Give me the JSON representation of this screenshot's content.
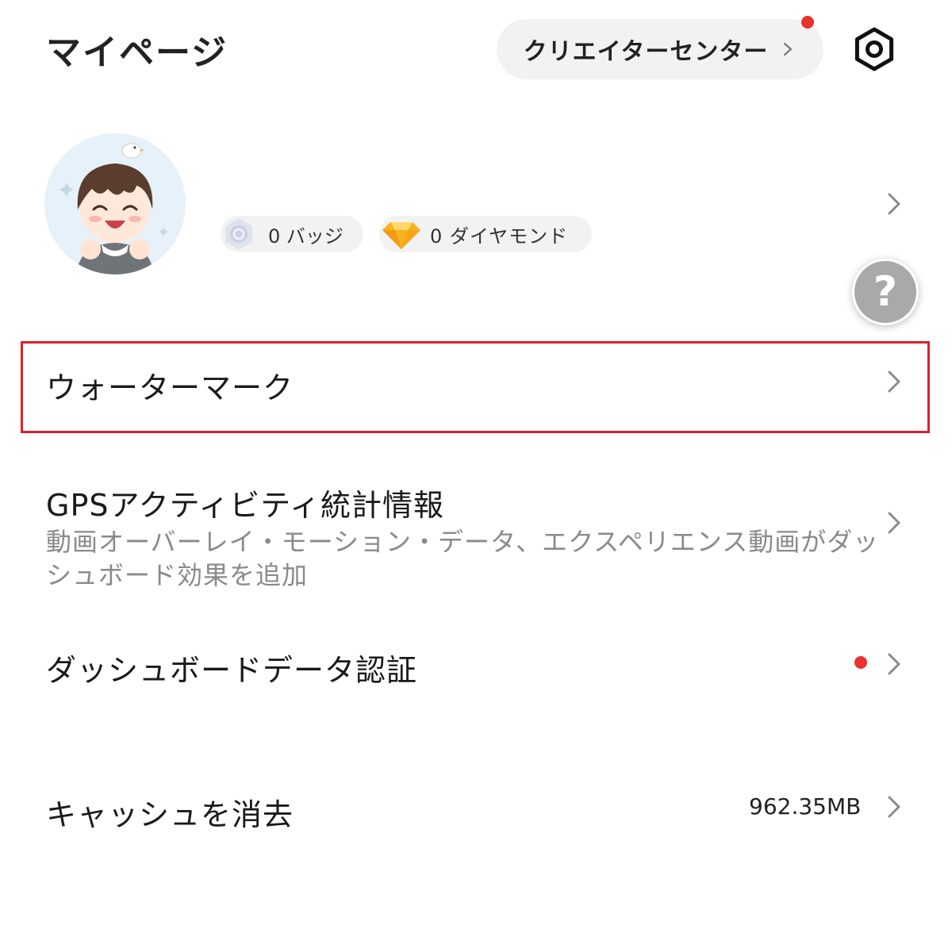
{
  "header": {
    "title": "マイページ",
    "creator_center_label": "クリエイターセンター",
    "creator_center_notification": true,
    "settings_icon": "settings-hex-icon"
  },
  "profile": {
    "avatar_icon": "avatar-cartoon-boy",
    "badges_label": "0 バッジ",
    "diamonds_label": "0  ダイヤモンド",
    "badge_icon": "badge-medal-icon",
    "diamond_icon": "diamond-icon"
  },
  "help": {
    "label": "?"
  },
  "menu": {
    "watermark": {
      "title": "ウォーターマーク"
    },
    "gps": {
      "title": "GPSアクティビティ統計情報",
      "subtitle_line1": "動画オーバーレイ・モーション・データ、エクスペリエンス動画がダッ",
      "subtitle_line2": "シュボード効果を追加"
    },
    "dashboard": {
      "title": "ダッシュボードデータ認証",
      "has_notification": true
    },
    "cache": {
      "title": "キャッシュを消去",
      "size": "962.35MB"
    }
  },
  "colors": {
    "notification_red": "#e8322b",
    "highlight_border": "#d9222a",
    "pill_bg": "#f2f2f2",
    "help_bg": "#a9a9a9"
  }
}
